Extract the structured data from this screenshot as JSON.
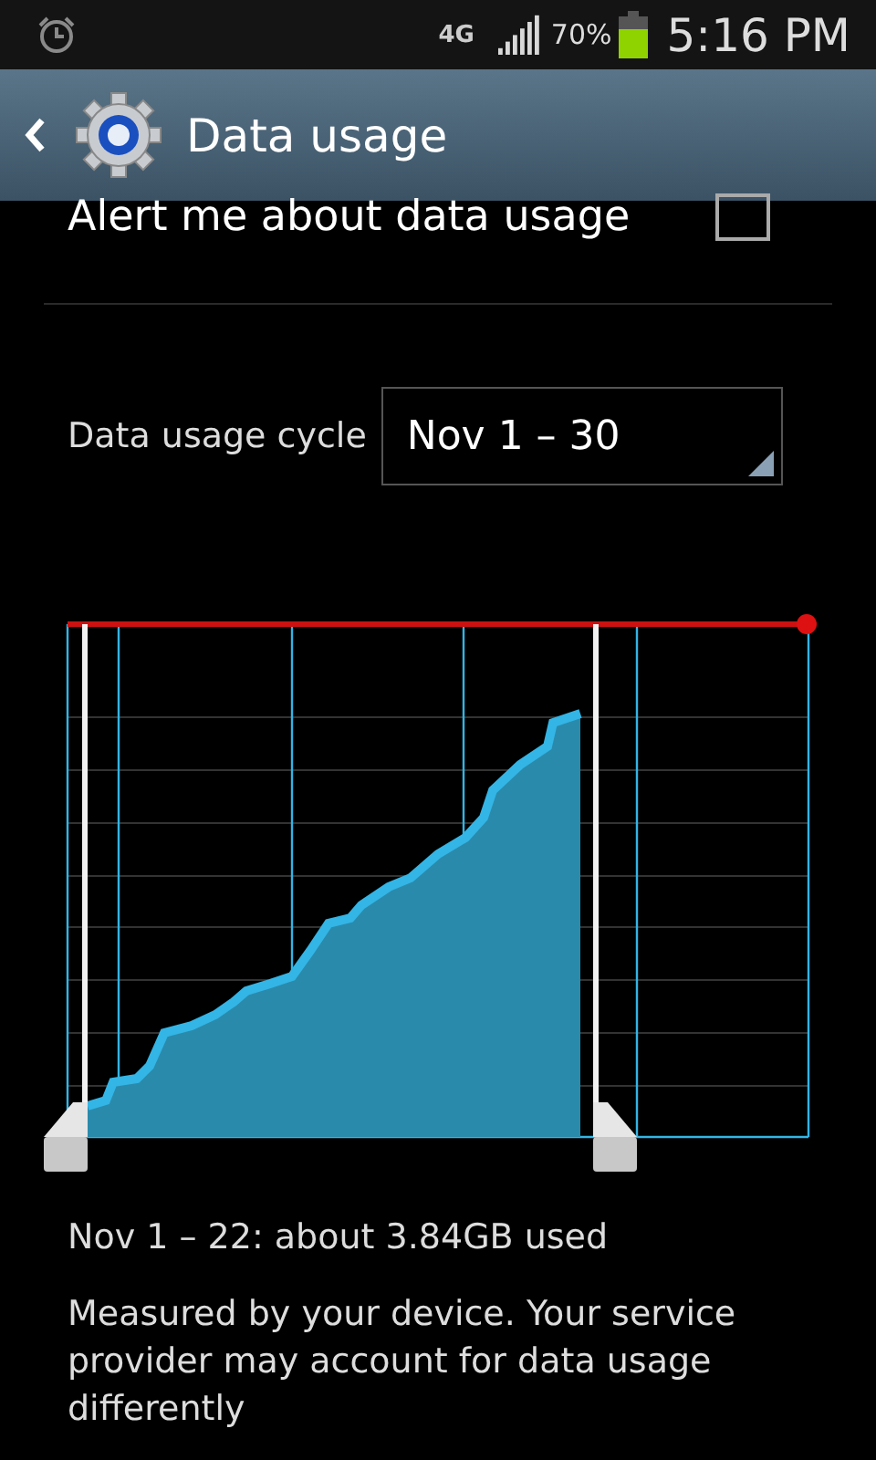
{
  "status_bar": {
    "network": "4G",
    "battery_percent": "70%",
    "time": "5:16 PM"
  },
  "action_bar": {
    "title": "Data usage"
  },
  "alert_setting": {
    "label": "Alert me about data usage",
    "checked": false
  },
  "cycle": {
    "label": "Data usage cycle",
    "value": "Nov 1 – 30"
  },
  "usage_summary": "Nov 1 – 22: about 3.84GB used",
  "note": "Measured by your device. Your service provider may account for data usage differently"
}
